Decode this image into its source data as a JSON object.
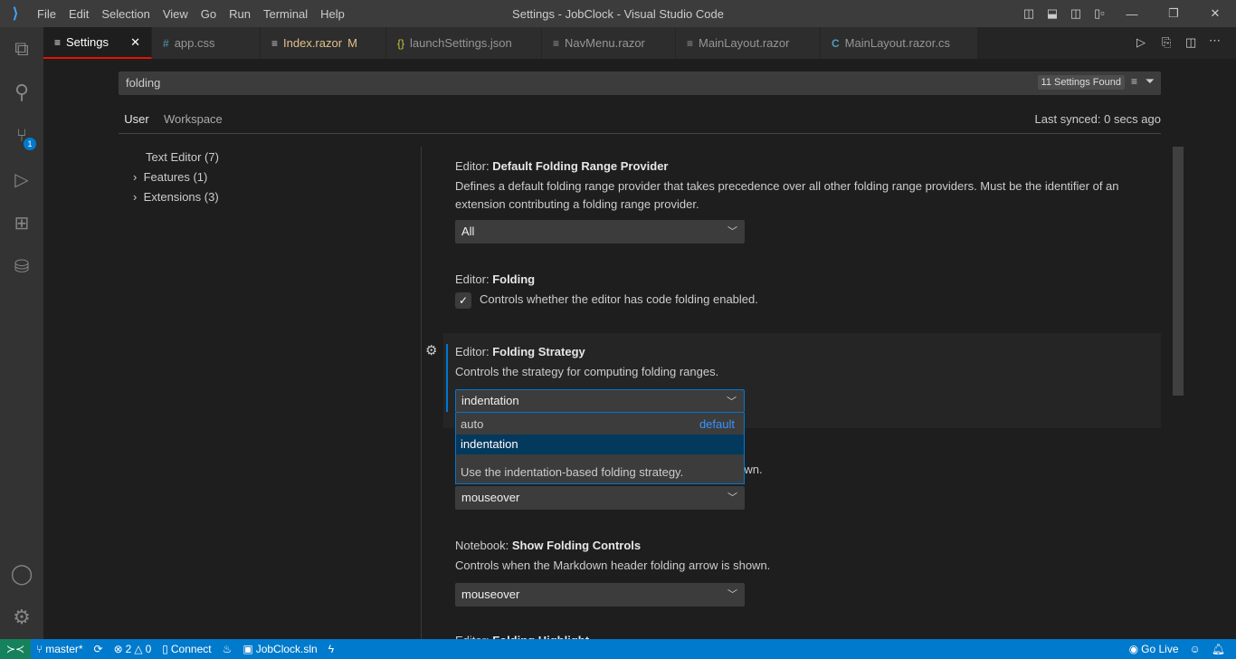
{
  "window": {
    "title": "Settings - JobClock - Visual Studio Code",
    "menu": [
      "File",
      "Edit",
      "Selection",
      "View",
      "Go",
      "Run",
      "Terminal",
      "Help"
    ]
  },
  "activity": {
    "source_control_badge": "1"
  },
  "tabs": [
    {
      "label": "Settings",
      "icon": "≡",
      "active": true,
      "close": "✕"
    },
    {
      "label": "app.css",
      "icon": "#"
    },
    {
      "label": "Index.razor",
      "icon": "≡",
      "modified": "M"
    },
    {
      "label": "launchSettings.json",
      "icon": "{}"
    },
    {
      "label": "NavMenu.razor",
      "icon": "≡"
    },
    {
      "label": "MainLayout.razor",
      "icon": "≡"
    },
    {
      "label": "MainLayout.razor.cs",
      "icon": "C"
    }
  ],
  "settings": {
    "search": "folding",
    "found": "11 Settings Found",
    "scope_tabs": [
      "User",
      "Workspace"
    ],
    "last_synced": "Last synced: 0 secs ago",
    "toc": [
      "Text Editor (7)",
      "Features (1)",
      "Extensions (3)"
    ],
    "items": [
      {
        "prefix": "Editor: ",
        "name": "Default Folding Range Provider",
        "desc": "Defines a default folding range provider that takes precedence over all other folding range providers. Must be the identifier of an extension contributing a folding range provider.",
        "value": "All"
      },
      {
        "prefix": "Editor: ",
        "name": "Folding",
        "desc": "Controls whether the editor has code folding enabled.",
        "checked": true
      },
      {
        "prefix": "Editor: ",
        "name": "Folding Strategy",
        "desc": "Controls the strategy for computing folding ranges.",
        "value": "indentation"
      },
      {
        "desc": "Controls when the folding controls on the gutter are shown.",
        "value": "mouseover"
      },
      {
        "prefix": "Notebook: ",
        "name": "Show Folding Controls",
        "desc": "Controls when the Markdown header folding arrow is shown.",
        "value": "mouseover"
      },
      {
        "prefix": "Editor: ",
        "name": "Folding Highlight"
      }
    ],
    "dropdown": {
      "options": [
        {
          "label": "auto",
          "tag": "default"
        },
        {
          "label": "indentation",
          "selected": true
        }
      ],
      "description": "Use the indentation-based folding strategy."
    }
  },
  "status": {
    "branch": "master*",
    "errors": "2",
    "warnings": "0",
    "connect": "Connect",
    "solution": "JobClock.sln",
    "golive": "Go Live"
  }
}
